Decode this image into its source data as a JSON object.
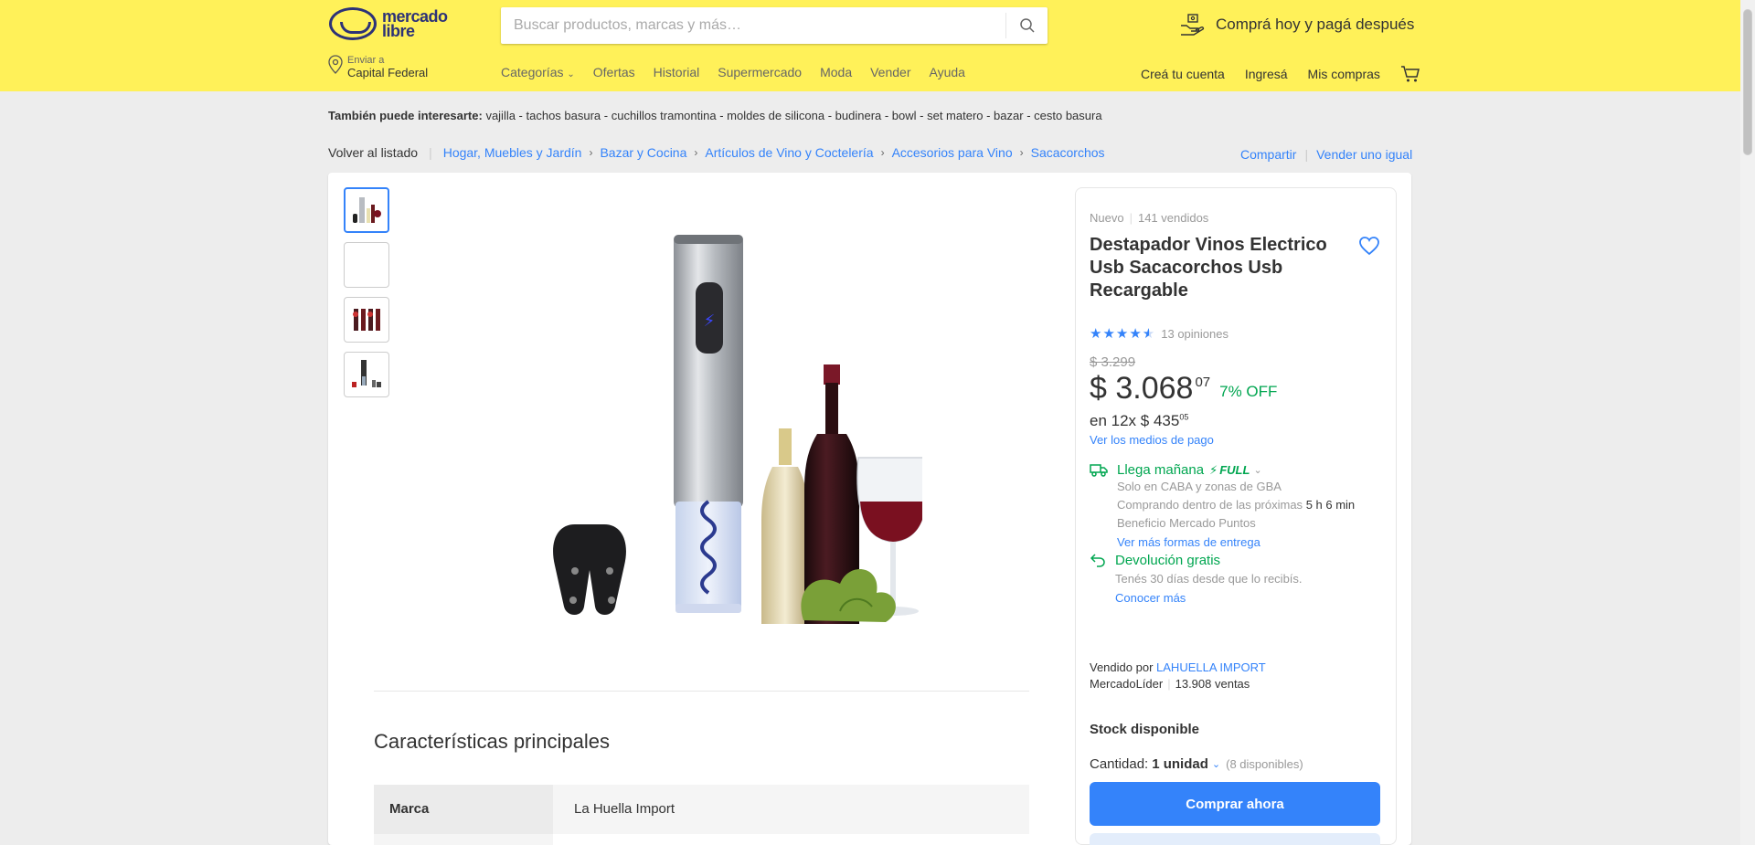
{
  "header": {
    "logo_line1": "mercado",
    "logo_line2": "libre",
    "search_placeholder": "Buscar productos, marcas y más…",
    "promo_text": "Comprá hoy y pagá después",
    "ship_label": "Enviar a",
    "ship_city": "Capital Federal",
    "nav": [
      "Categorías",
      "Ofertas",
      "Historial",
      "Supermercado",
      "Moda",
      "Vender",
      "Ayuda"
    ],
    "user_nav": [
      "Creá tu cuenta",
      "Ingresá",
      "Mis compras"
    ]
  },
  "interests": {
    "label": "También puede interesarte:",
    "items": "vajilla - tachos basura - cuchillos tramontina - moldes de silicona - budinera - bowl - set matero - bazar - cesto basura"
  },
  "breadcrumb": {
    "back": "Volver al listado",
    "crumbs": [
      "Hogar, Muebles y Jardín",
      "Bazar y Cocina",
      "Artículos de Vino y Coctelería",
      "Accesorios para Vino",
      "Sacacorchos"
    ],
    "share": "Compartir",
    "sell_same": "Vender uno igual"
  },
  "product": {
    "condition": "Nuevo",
    "sold": "141 vendidos",
    "title": "Destapador Vinos Electrico Usb Sacacorchos Usb Recargable",
    "rating_value": 4.5,
    "reviews": "13 opiniones",
    "old_price": "$ 3.299",
    "price_main": "$ 3.068",
    "price_cents": "07",
    "discount": "7% OFF",
    "installments_prefix": "en 12x $ 435",
    "installments_cents": "05",
    "payment_link": "Ver los medios de pago"
  },
  "delivery": {
    "title": "Llega mañana",
    "full": "FULL",
    "line1": "Solo en CABA y zonas de GBA",
    "line2": "Comprando dentro de las próximas",
    "time": "5 h 6 min",
    "line3": "Beneficio Mercado Puntos",
    "link": "Ver más formas de entrega"
  },
  "returns": {
    "title": "Devolución gratis",
    "text": "Tenés 30 días desde que lo recibís.",
    "link": "Conocer más"
  },
  "seller": {
    "prefix": "Vendido por",
    "name": "LAHUELLA IMPORT",
    "badge": "MercadoLíder",
    "sales": "13.908 ventas"
  },
  "purchase": {
    "stock": "Stock disponible",
    "qty_label": "Cantidad:",
    "qty_value": "1 unidad",
    "available": "(8 disponibles)",
    "buy_label": "Comprar ahora"
  },
  "characteristics": {
    "title": "Características principales",
    "rows": [
      {
        "key": "Marca",
        "value": "La Huella Import"
      },
      {
        "key": "",
        "value": ""
      }
    ]
  },
  "colors": {
    "header_bg": "#fff159",
    "accent": "#3483fa",
    "green": "#00a650"
  }
}
